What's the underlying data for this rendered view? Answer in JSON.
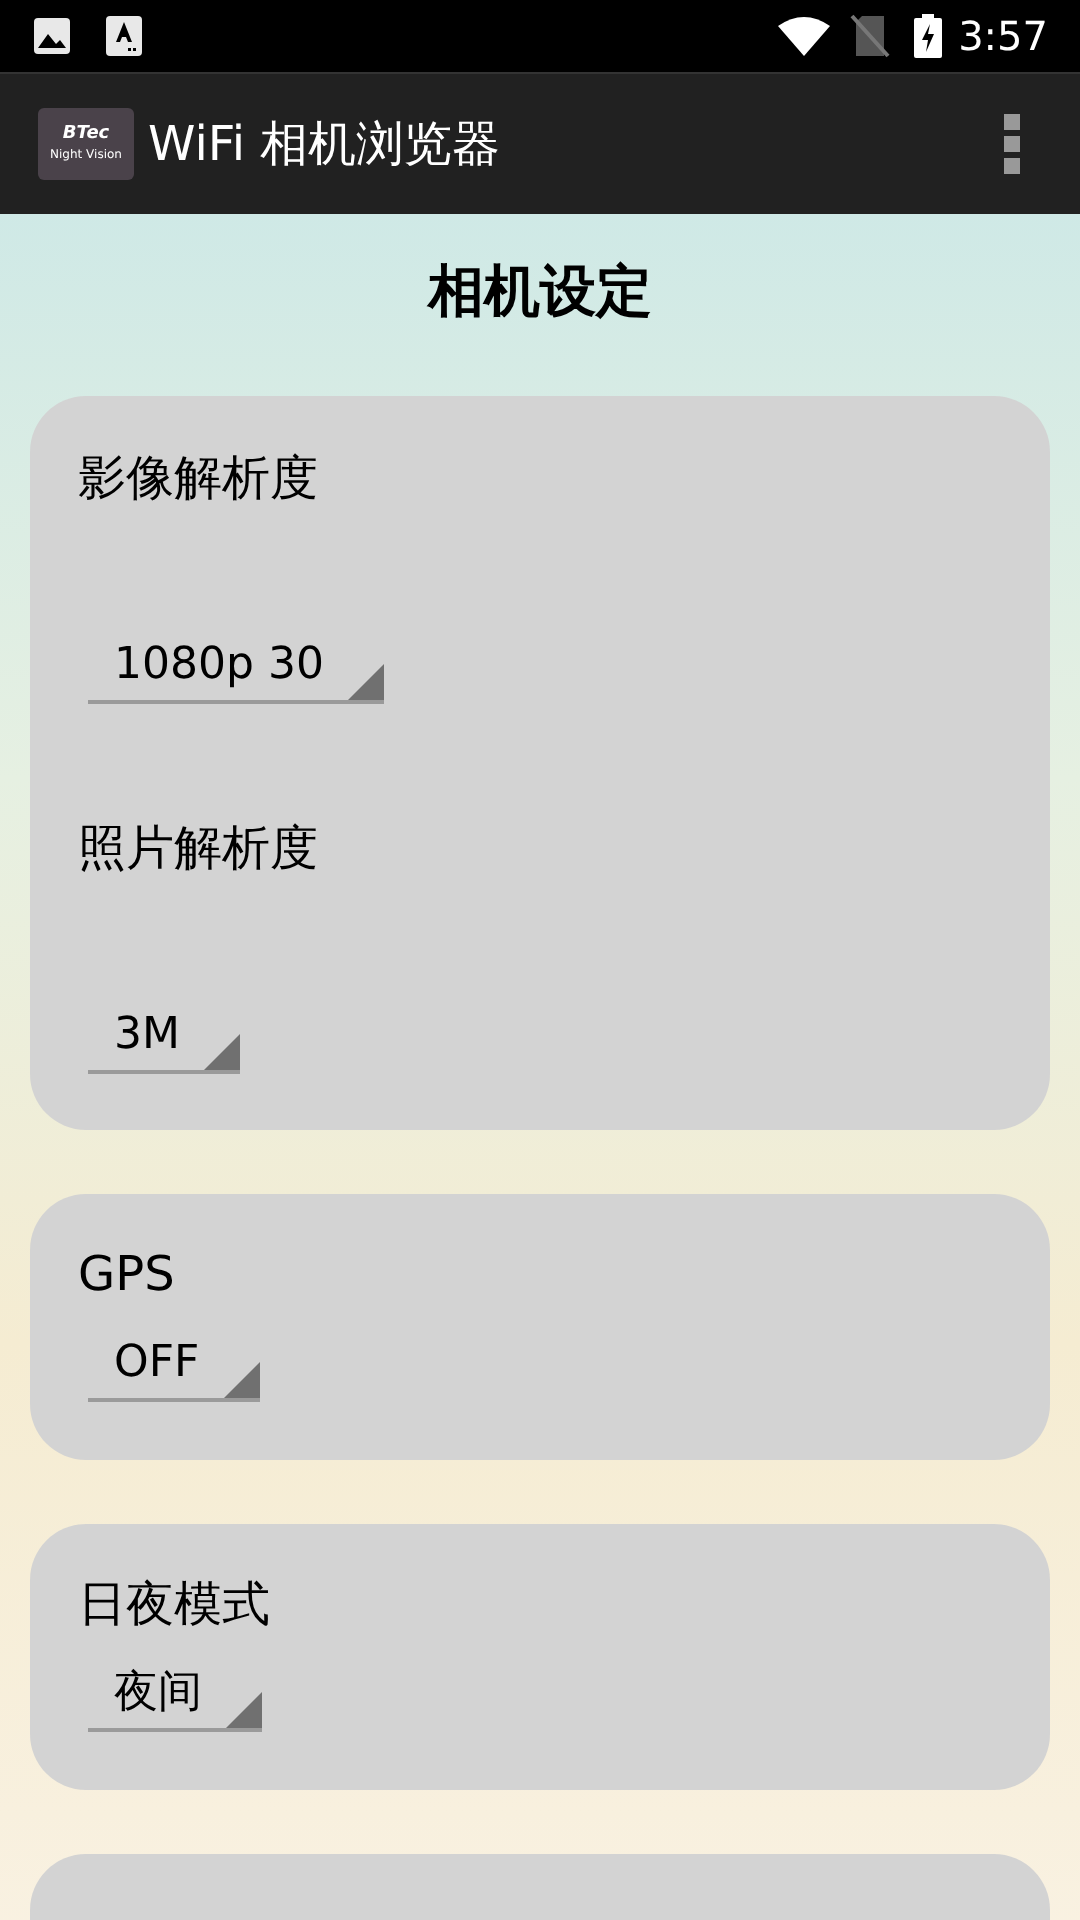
{
  "status_bar": {
    "time": "3:57"
  },
  "app_bar": {
    "logo": {
      "brand": "BTec",
      "tagline": "Night Vision"
    },
    "title": "WiFi 相机浏览器"
  },
  "page_title": "相机设定",
  "cards": [
    {
      "kind": "settings",
      "spacious": true,
      "settings": [
        {
          "label": "影像解析度",
          "value": "1080p 30"
        },
        {
          "label": "照片解析度",
          "value": "3M"
        }
      ]
    },
    {
      "kind": "settings",
      "spacious": false,
      "settings": [
        {
          "label": "GPS",
          "value": "OFF"
        }
      ]
    },
    {
      "kind": "settings",
      "spacious": false,
      "settings": [
        {
          "label": "日夜模式",
          "value": "夜间"
        }
      ]
    },
    {
      "kind": "blank"
    }
  ]
}
